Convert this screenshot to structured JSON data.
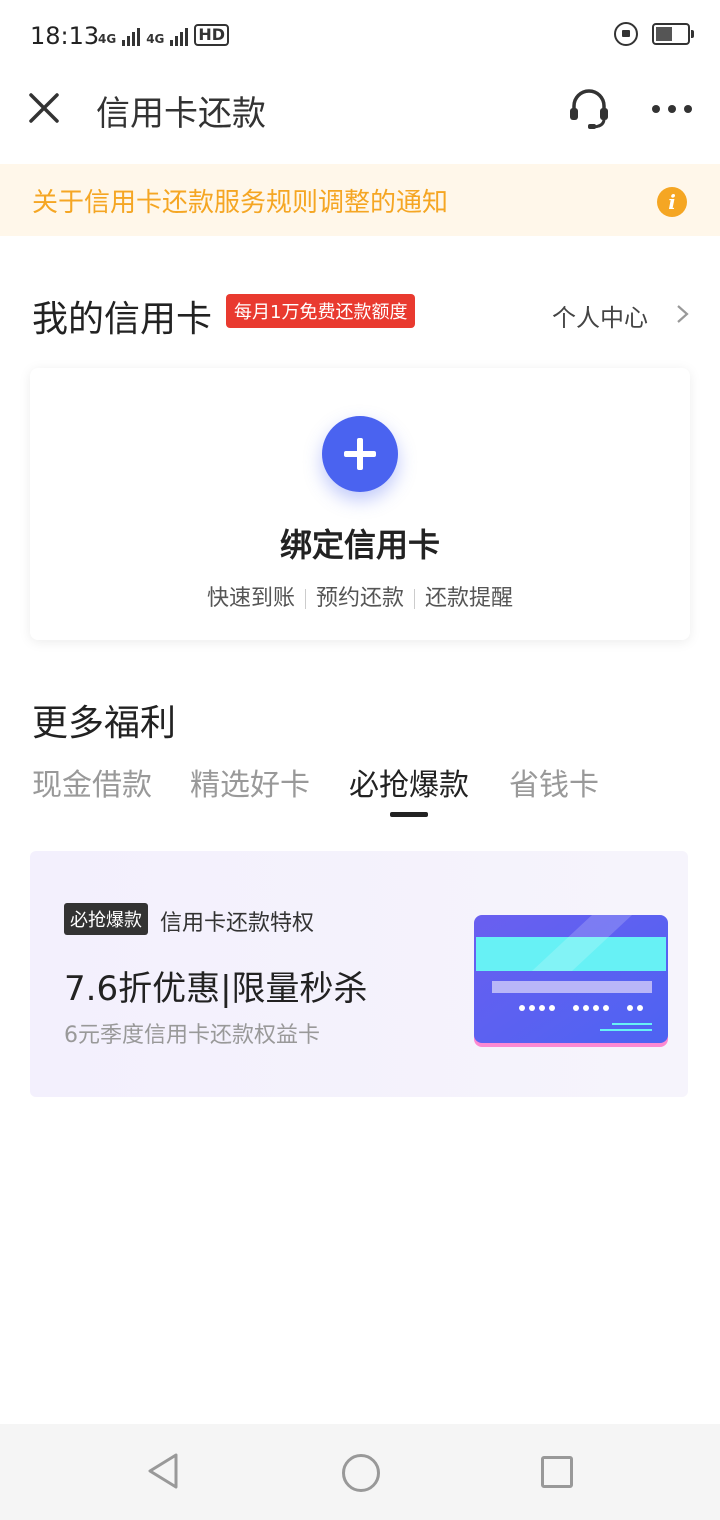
{
  "status_bar": {
    "time": "18:13",
    "network_1": "4G",
    "network_2": "4G",
    "hd": "HD",
    "icons": [
      "signal-icon",
      "signal-icon",
      "hd-icon",
      "rotation-lock-icon",
      "battery-icon"
    ]
  },
  "nav": {
    "title": "信用卡还款",
    "close_icon": "close-icon",
    "service_icon": "headset-icon",
    "more_icon": "more-icon"
  },
  "notice": {
    "text": "关于信用卡还款服务规则调整的通知",
    "icon": "info-icon",
    "icon_glyph": "i",
    "color": "#f5a623"
  },
  "my_cards": {
    "title": "我的信用卡",
    "badge": "每月1万免费还款额度",
    "personal_center": "个人中心"
  },
  "bind_card": {
    "title": "绑定信用卡",
    "features": [
      "快速到账",
      "预约还款",
      "还款提醒"
    ],
    "accent": "#4a63f0"
  },
  "more_benefits": {
    "title": "更多福利",
    "tabs": [
      "现金借款",
      "精选好卡",
      "必抢爆款",
      "省钱卡"
    ],
    "active_tab": "必抢爆款"
  },
  "promo": {
    "tag": "必抢爆款",
    "subtitle": "信用卡还款特权",
    "headline": "7.6折优惠|限量秒杀",
    "description": "6元季度信用卡还款权益卡"
  },
  "system_nav": {
    "icons": [
      "back-icon",
      "home-icon",
      "recent-apps-icon"
    ]
  }
}
